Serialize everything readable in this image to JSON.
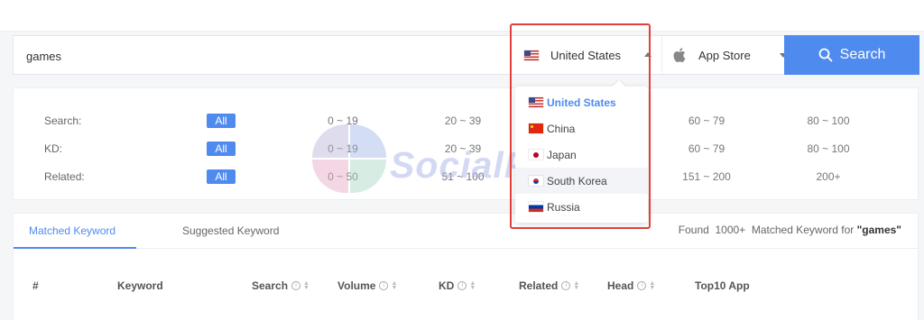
{
  "search": {
    "query": "games",
    "country_selected": "United States",
    "store_selected": "App Store",
    "button_label": "Search"
  },
  "filters": {
    "rows": [
      {
        "label": "Search:",
        "all": "All",
        "options": [
          "0 ~ 19",
          "20 ~ 39",
          "60 ~ 79",
          "80 ~ 100"
        ]
      },
      {
        "label": "KD:",
        "all": "All",
        "options": [
          "0 ~ 19",
          "20 ~ 39",
          "60 ~ 79",
          "80 ~ 100"
        ]
      },
      {
        "label": "Related:",
        "all": "All",
        "options": [
          "0 ~ 50",
          "51 ~ 100",
          "151 ~ 200",
          "200+"
        ]
      }
    ]
  },
  "watermark": "SocialPeta",
  "country_dropdown": {
    "items": [
      {
        "label": "United States",
        "flag": "us-flag",
        "selected": true
      },
      {
        "label": "China",
        "flag": "cn-flag"
      },
      {
        "label": "Japan",
        "flag": "jp-flag"
      },
      {
        "label": "South Korea",
        "flag": "kr-flag",
        "hovered": true
      },
      {
        "label": "Russia",
        "flag": "ru-flag"
      }
    ]
  },
  "results": {
    "tabs": [
      "Matched Keyword",
      "Suggested Keyword"
    ],
    "found_prefix": "Found",
    "found_count": "1000+",
    "found_middle": "Matched Keyword for",
    "found_query": "\"games\"",
    "columns": [
      "#",
      "Keyword",
      "Search",
      "Volume",
      "KD",
      "Related",
      "Head",
      "Top10 App"
    ]
  },
  "colors": {
    "accent": "#4f8bef",
    "highlight": "#e2403a"
  }
}
